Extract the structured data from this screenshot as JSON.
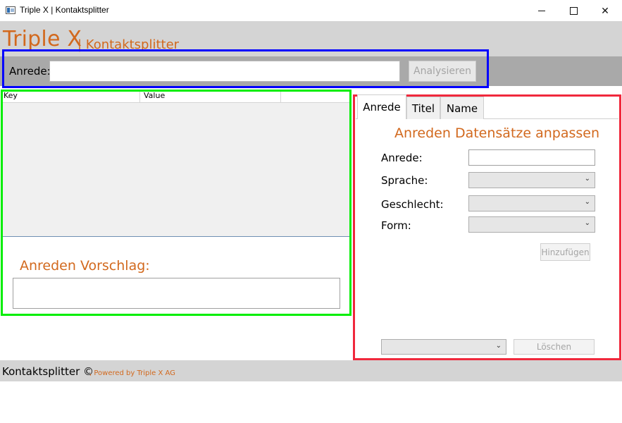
{
  "window": {
    "title": "Triple X | Kontaktsplitter",
    "minimize_icon": "minimize-icon",
    "maximize_icon": "maximize-icon",
    "close_icon": "close-icon",
    "close_glyph": "✕"
  },
  "header": {
    "brand": "Triple X",
    "subtitle": "| Kontaktsplitter"
  },
  "input_bar": {
    "label": "Anrede:",
    "value": "",
    "analyze_label": "Analysieren"
  },
  "result_grid": {
    "columns": [
      "Key",
      "Value"
    ]
  },
  "suggestion": {
    "heading": "Anreden Vorschlag:",
    "value": ""
  },
  "tabs": [
    {
      "label": "Anrede",
      "selected": true
    },
    {
      "label": "Titel",
      "selected": false
    },
    {
      "label": "Name",
      "selected": false
    }
  ],
  "form": {
    "heading": "Anreden Datensätze anpassen",
    "anrede_label": "Anrede:",
    "sprache_label": "Sprache:",
    "geschlecht_label": "Geschlecht:",
    "form_label": "Form:",
    "add_label": "Hinzufügen",
    "delete_label": "Löschen",
    "chevron": "⌄"
  },
  "footer": {
    "copyright": "Kontaktsplitter ©",
    "powered": ", Powered by Triple X AG"
  },
  "colors": {
    "accent": "#d2691e",
    "band": "#d4d4d4",
    "input_band": "#a9a9a9",
    "outline_blue": "#0000ff",
    "outline_green": "#00ee00",
    "outline_red": "#f0283c"
  }
}
